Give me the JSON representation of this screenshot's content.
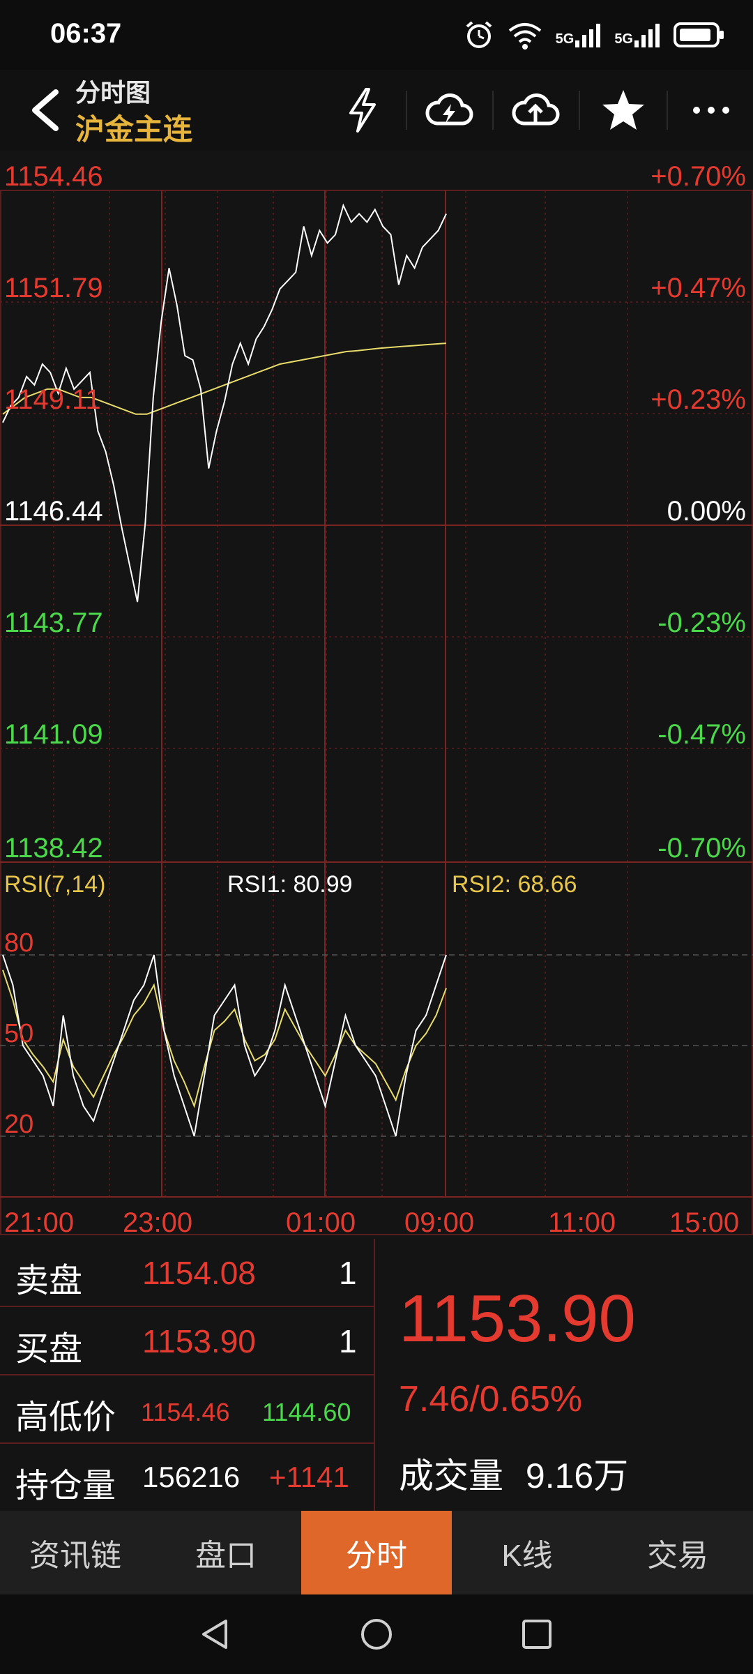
{
  "status": {
    "time": "06:37",
    "signal1": "5G",
    "signal2": "5G",
    "wifi_label": "6"
  },
  "header": {
    "title": "分时图",
    "subtitle": "沪金主连"
  },
  "price_axis": {
    "left": [
      "1154.46",
      "1151.79",
      "1149.11",
      "1146.44",
      "1143.77",
      "1141.09",
      "1138.42"
    ],
    "right": [
      "+0.70%",
      "+0.47%",
      "+0.23%",
      "0.00%",
      "-0.23%",
      "-0.47%",
      "-0.70%"
    ]
  },
  "rsi": {
    "label": "RSI(7,14)",
    "rsi1": "RSI1: 80.99",
    "rsi2": "RSI2: 68.66",
    "levels": [
      "80",
      "50",
      "20"
    ]
  },
  "time_axis": [
    "21:00",
    "23:00",
    "01:00",
    "09:00",
    "11:00",
    "15:00"
  ],
  "quote": {
    "sell_label": "卖盘",
    "sell_price": "1154.08",
    "sell_qty": "1",
    "buy_label": "买盘",
    "buy_price": "1153.90",
    "buy_qty": "1",
    "hl_label": "高低价",
    "high": "1154.46",
    "low": "1144.60",
    "oi_label": "持仓量",
    "oi": "156216",
    "oi_change": "+1141",
    "last": "1153.90",
    "change": "7.46/0.65%",
    "volume_label": "成交量",
    "volume": "9.16万"
  },
  "tabs": [
    "资讯链",
    "盘口",
    "分时",
    "K线",
    "交易"
  ],
  "colors": {
    "up": "#e53a2f",
    "down": "#4bd94b",
    "accent": "#e0672a",
    "gold": "#e7b43c"
  },
  "chart_data": {
    "type": "line",
    "price_range": [
      1138.42,
      1154.46
    ],
    "prev_close": 1146.44,
    "price_series": [
      1148.9,
      1149.3,
      1149.5,
      1150.0,
      1149.8,
      1150.3,
      1150.1,
      1149.6,
      1150.2,
      1149.7,
      1149.9,
      1150.1,
      1148.7,
      1148.2,
      1147.4,
      1146.4,
      1145.5,
      1144.6,
      1146.5,
      1149.5,
      1151.3,
      1152.6,
      1151.7,
      1150.5,
      1150.4,
      1149.7,
      1147.8,
      1148.7,
      1149.4,
      1150.3,
      1150.8,
      1150.3,
      1150.9,
      1151.2,
      1151.6,
      1152.1,
      1152.3,
      1152.5,
      1153.6,
      1152.9,
      1153.5,
      1153.2,
      1153.4,
      1154.1,
      1153.7,
      1153.9,
      1153.7,
      1154.0,
      1153.6,
      1153.4,
      1152.2,
      1152.9,
      1152.6,
      1153.1,
      1153.3,
      1153.5,
      1153.9
    ],
    "avg_series": [
      1149.1,
      1149.3,
      1149.5,
      1149.6,
      1149.7,
      1149.7,
      1149.6,
      1149.5,
      1149.5,
      1149.4,
      1149.3,
      1149.2,
      1149.1,
      1149.1,
      1149.2,
      1149.3,
      1149.4,
      1149.5,
      1149.6,
      1149.7,
      1149.8,
      1149.9,
      1150.0,
      1150.1,
      1150.2,
      1150.3,
      1150.35,
      1150.4,
      1150.45,
      1150.5,
      1150.55,
      1150.6,
      1150.62,
      1150.65,
      1150.68,
      1150.7,
      1150.72,
      1150.74,
      1150.76,
      1150.78,
      1150.8
    ],
    "rsi_range": [
      0,
      100
    ],
    "rsi1_series": [
      80,
      70,
      50,
      45,
      40,
      30,
      60,
      40,
      30,
      25,
      35,
      45,
      55,
      65,
      70,
      80,
      55,
      40,
      30,
      20,
      40,
      60,
      65,
      70,
      50,
      40,
      45,
      55,
      70,
      60,
      50,
      40,
      30,
      45,
      60,
      50,
      45,
      40,
      30,
      20,
      40,
      55,
      60,
      70,
      80
    ],
    "rsi2_series": [
      75,
      65,
      52,
      47,
      43,
      38,
      52,
      43,
      38,
      33,
      40,
      47,
      53,
      60,
      64,
      70,
      55,
      45,
      38,
      30,
      43,
      55,
      58,
      62,
      52,
      45,
      47,
      52,
      62,
      56,
      50,
      45,
      40,
      47,
      55,
      50,
      47,
      44,
      38,
      32,
      42,
      50,
      54,
      60,
      69
    ],
    "x_labels": [
      "21:00",
      "23:00",
      "01:00",
      "09:00",
      "11:00",
      "15:00"
    ]
  }
}
